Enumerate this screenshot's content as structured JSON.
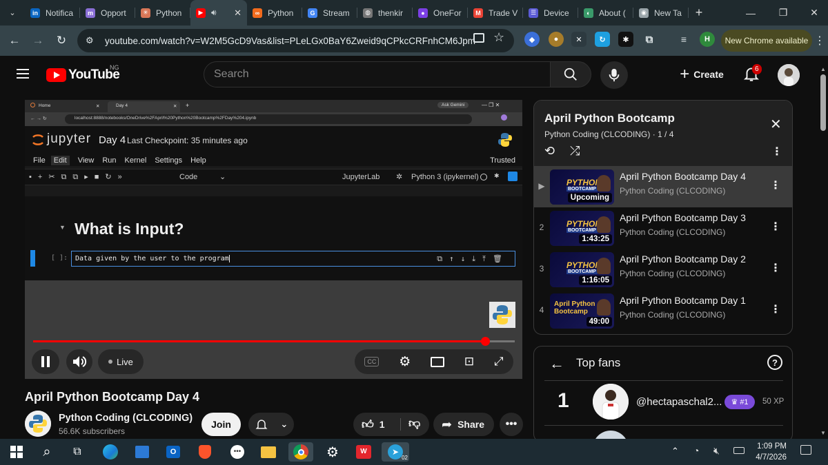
{
  "browser": {
    "tabs": [
      {
        "label": "Notifica",
        "icon": "linkedin-icon",
        "color": "#0a66c2",
        "glyph": "in"
      },
      {
        "label": "Opport",
        "icon": "m-icon",
        "color": "#8a6fd6",
        "glyph": "m"
      },
      {
        "label": "Python",
        "icon": "spark-icon",
        "color": "#d97757",
        "glyph": "✳"
      },
      {
        "label": "",
        "icon": "youtube-icon",
        "color": "#ff0000",
        "glyph": "▶",
        "active": true
      },
      {
        "label": "Python",
        "icon": "coursera-icon",
        "color": "#f26b1d",
        "glyph": "∞"
      },
      {
        "label": "Stream",
        "icon": "google-icon",
        "color": "#4285f4",
        "glyph": "G"
      },
      {
        "label": "thenkir",
        "icon": "globe-icon",
        "color": "#777777",
        "glyph": "◍"
      },
      {
        "label": "OneFor",
        "icon": "circle-icon",
        "color": "#7b3fe4",
        "glyph": "●"
      },
      {
        "label": "Trade V",
        "icon": "gmail-icon",
        "color": "#ea4335",
        "glyph": "M"
      },
      {
        "label": "Device",
        "icon": "app-icon",
        "color": "#5b5bd6",
        "glyph": "☰"
      },
      {
        "label": "About (",
        "icon": "edge-icon",
        "color": "#3a9a6a",
        "glyph": "◐"
      },
      {
        "label": "New Ta",
        "icon": "chrome-icon",
        "color": "#9aa5aa",
        "glyph": "◉"
      }
    ],
    "url": "youtube.com/watch?v=W2M5GcD9Vas&list=PLeLGx0BaY6Zweid9qCPkcCRFnhCM6Jpm",
    "update_label": "New Chrome available",
    "profile_initial": "H"
  },
  "youtube": {
    "logo_text": "YouTube",
    "country": "NG",
    "search_placeholder": "Search",
    "create_label": "Create",
    "notification_count": "6"
  },
  "player": {
    "inner_tabs": [
      "Home",
      "Day 4"
    ],
    "inner_url": "localhost:8888/notebooks/OneDrive%2FApril%20Python%20Bootcamp%2FDay%204.ipynb",
    "ask_gemini": "Ask Gemini",
    "jupyter_logo": "jupyter",
    "notebook_name": "Day 4",
    "checkpoint": "Last Checkpoint: 35 minutes ago",
    "menu": [
      "File",
      "Edit",
      "View",
      "Run",
      "Kernel",
      "Settings",
      "Help"
    ],
    "trusted": "Trusted",
    "cell_type": "Code",
    "jupyterlab_label": "JupyterLab",
    "kernel": "Python 3 (ipykernel)",
    "heading": "What is Input?",
    "prompt": "[ ]:",
    "cell_text": "Data given by the user to the program",
    "live_label": "Live",
    "progress": 0.938
  },
  "video": {
    "title": "April Python Bootcamp Day 4",
    "channel": "Python Coding (CLCODING)",
    "subscribers": "56.6K subscribers",
    "join_label": "Join",
    "likes": "1",
    "share_label": "Share"
  },
  "playlist": {
    "title": "April Python Bootcamp",
    "subtitle": "Python Coding (CLCODING) · 1 / 4",
    "items": [
      {
        "index": "▶",
        "title": "April Python Bootcamp Day 4",
        "channel": "Python Coding (CLCODING)",
        "duration": "Upcoming",
        "thumb_text": "PYTHON"
      },
      {
        "index": "2",
        "title": "April Python Bootcamp Day 3",
        "channel": "Python Coding (CLCODING)",
        "duration": "1:43:25",
        "thumb_text": "PYTHON"
      },
      {
        "index": "3",
        "title": "April Python Bootcamp Day 2",
        "channel": "Python Coding (CLCODING)",
        "duration": "1:16:05",
        "thumb_text": "PYTHON"
      },
      {
        "index": "4",
        "title": "April Python Bootcamp Day 1",
        "channel": "Python Coding (CLCODING)",
        "duration": "49:00",
        "thumb_text": "April Python Bootcamp"
      }
    ]
  },
  "fans": {
    "title": "Top fans",
    "rank": "1",
    "name": "@hectapaschal2...",
    "badge": "#1",
    "xp": "50 XP"
  },
  "taskbar": {
    "time": "1:09 PM",
    "date": "4/7/2026",
    "telegram_badge": "02"
  }
}
